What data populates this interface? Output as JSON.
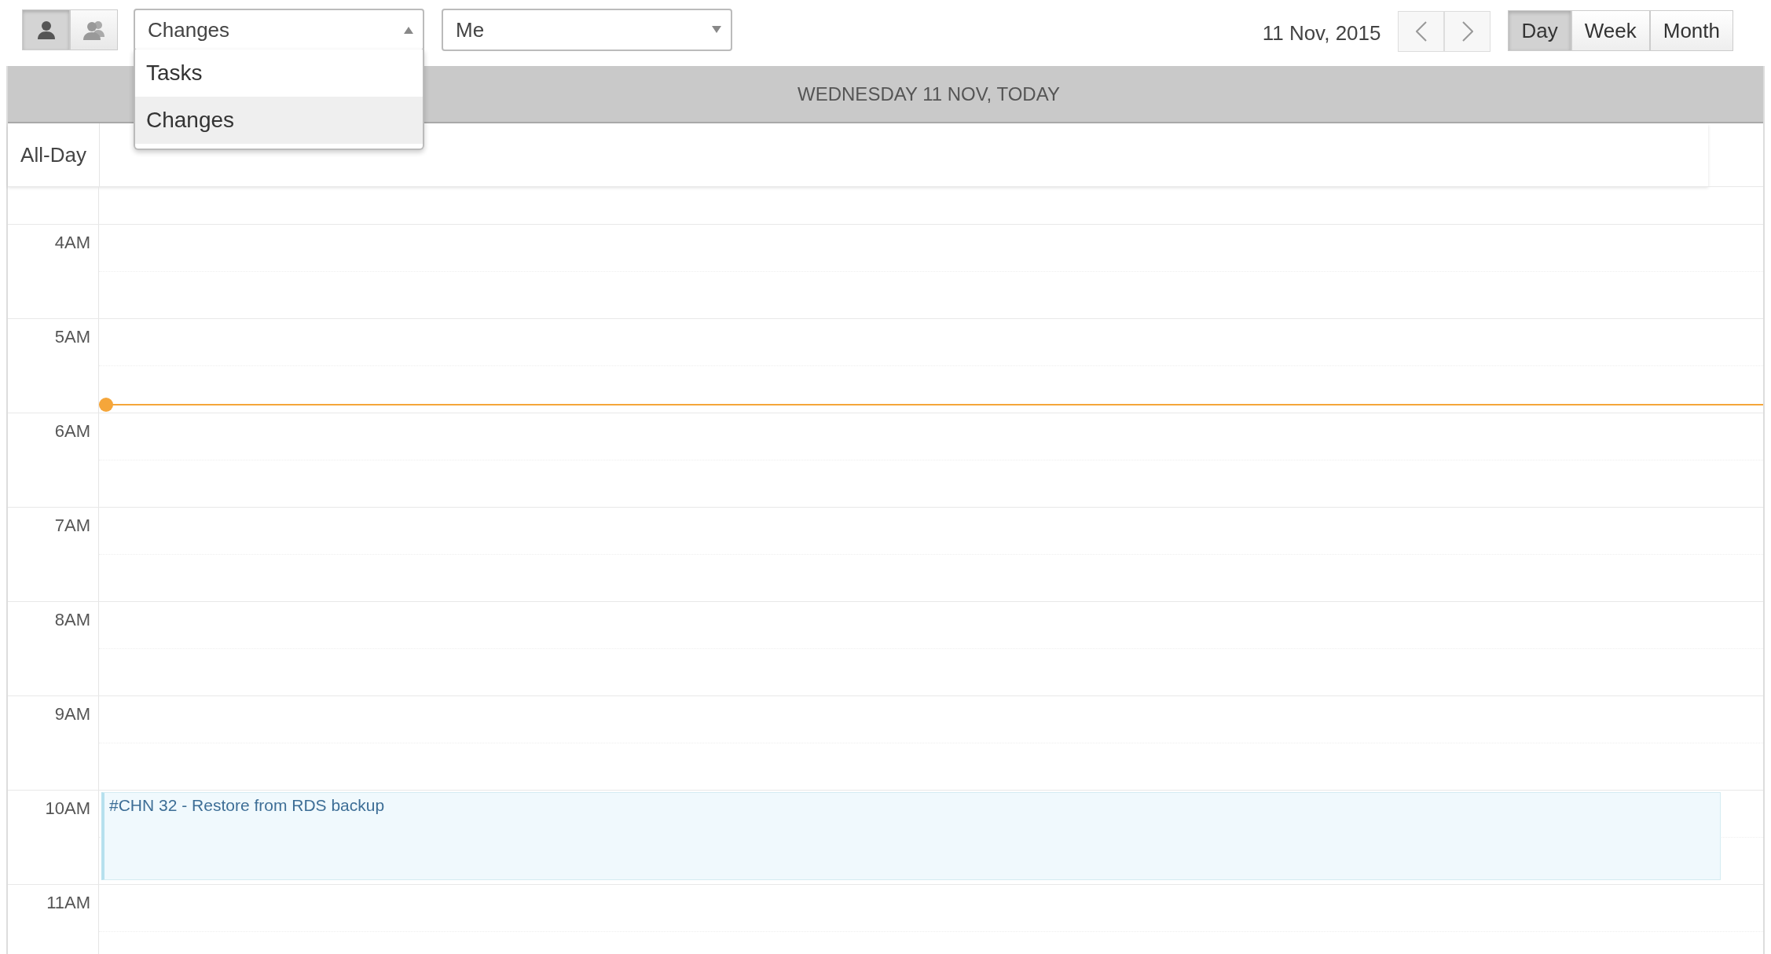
{
  "toolbar": {
    "view_toggles": [
      {
        "kind": "single",
        "selected": true
      },
      {
        "kind": "group",
        "selected": false
      }
    ],
    "type_select": {
      "value": "Changes",
      "open": true,
      "options": [
        {
          "label": "Tasks",
          "selected": false
        },
        {
          "label": "Changes",
          "selected": true
        }
      ]
    },
    "owner_select": {
      "value": "Me"
    },
    "date": "11 Nov, 2015",
    "views": [
      {
        "label": "Day",
        "selected": true
      },
      {
        "label": "Week",
        "selected": false
      },
      {
        "label": "Month",
        "selected": false
      }
    ]
  },
  "day_header": "WEDNESDAY 11 NOV, TODAY",
  "all_day_label": "All-Day",
  "hours": [
    {
      "label": "4AM",
      "now": false
    },
    {
      "label": "5AM",
      "now": true
    },
    {
      "label": "6AM",
      "now": false
    },
    {
      "label": "7AM",
      "now": false
    },
    {
      "label": "8AM",
      "now": false
    },
    {
      "label": "9AM",
      "now": false
    },
    {
      "label": "10AM",
      "now": false,
      "events": [
        {
          "title": "#CHN 32 - Restore from RDS backup"
        }
      ]
    },
    {
      "label": "11AM",
      "now": false
    }
  ]
}
